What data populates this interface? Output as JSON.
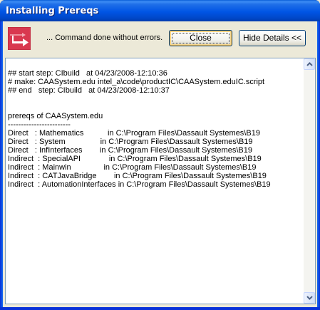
{
  "window": {
    "title": "Installing Prereqs"
  },
  "status": {
    "message": "... Command done without errors.",
    "icon": "arrow-icon"
  },
  "buttons": {
    "close_label": "Close",
    "details_label": "Hide Details <<"
  },
  "log": {
    "lines": [
      "## start step: CIbuild   at 04/23/2008-12:10:36",
      "# make: CAASystem.edu intel_a\\code\\productIC\\CAASystem.eduIC.script",
      "## end   step: CIbuild   at 04/23/2008-12:10:37",
      "",
      "",
      "prereqs of CAASystem.edu",
      "------------------------",
      "Direct   : Mathematics           in C:\\Program Files\\Dassault Systemes\\B19",
      "Direct   : System                in C:\\Program Files\\Dassault Systemes\\B19",
      "Direct   : InfInterfaces        in C:\\Program Files\\Dassault Systemes\\B19",
      "Indirect  : SpecialAPI             in C:\\Program Files\\Dassault Systemes\\B19",
      "Indirect  : Mainwin               in C:\\Program Files\\Dassault Systemes\\B19",
      "Indirect  : CATJavaBridge        in C:\\Program Files\\Dassault Systemes\\B19",
      "Indirect  : AutomationInterfaces in C:\\Program Files\\Dassault Systemes\\B19"
    ]
  },
  "colors": {
    "titlebar": "#0055e5",
    "icon_bg": "#d9384f"
  }
}
